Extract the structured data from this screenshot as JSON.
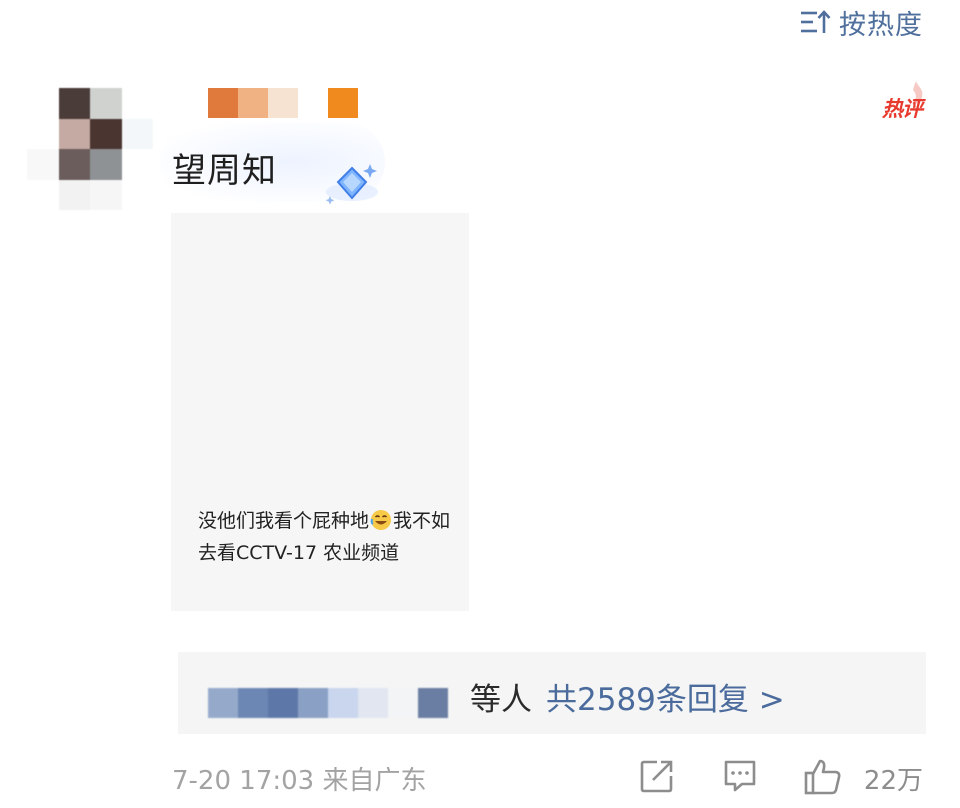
{
  "sort": {
    "label": "按热度",
    "icon": "sort-icon"
  },
  "comment": {
    "username": "望周知",
    "hot_badge": "热评",
    "text_before_emoji": "没他们我看个屁种地",
    "emoji": "laughing-rolling-face-icon",
    "text_after_emoji": "我不如去看CCTV-17 农业频道",
    "timestamp": "7-20 17:03 来自广东"
  },
  "replies": {
    "prefix": "等人",
    "count_label": "共2589条回复 >"
  },
  "actions": {
    "forward_icon": "share-icon",
    "comment_icon": "comment-icon",
    "like_icon": "thumbs-up-icon",
    "like_count": "22万"
  },
  "colors": {
    "link": "#4a6b9c",
    "hot": "#e8392e",
    "muted": "#a3a3a3"
  }
}
